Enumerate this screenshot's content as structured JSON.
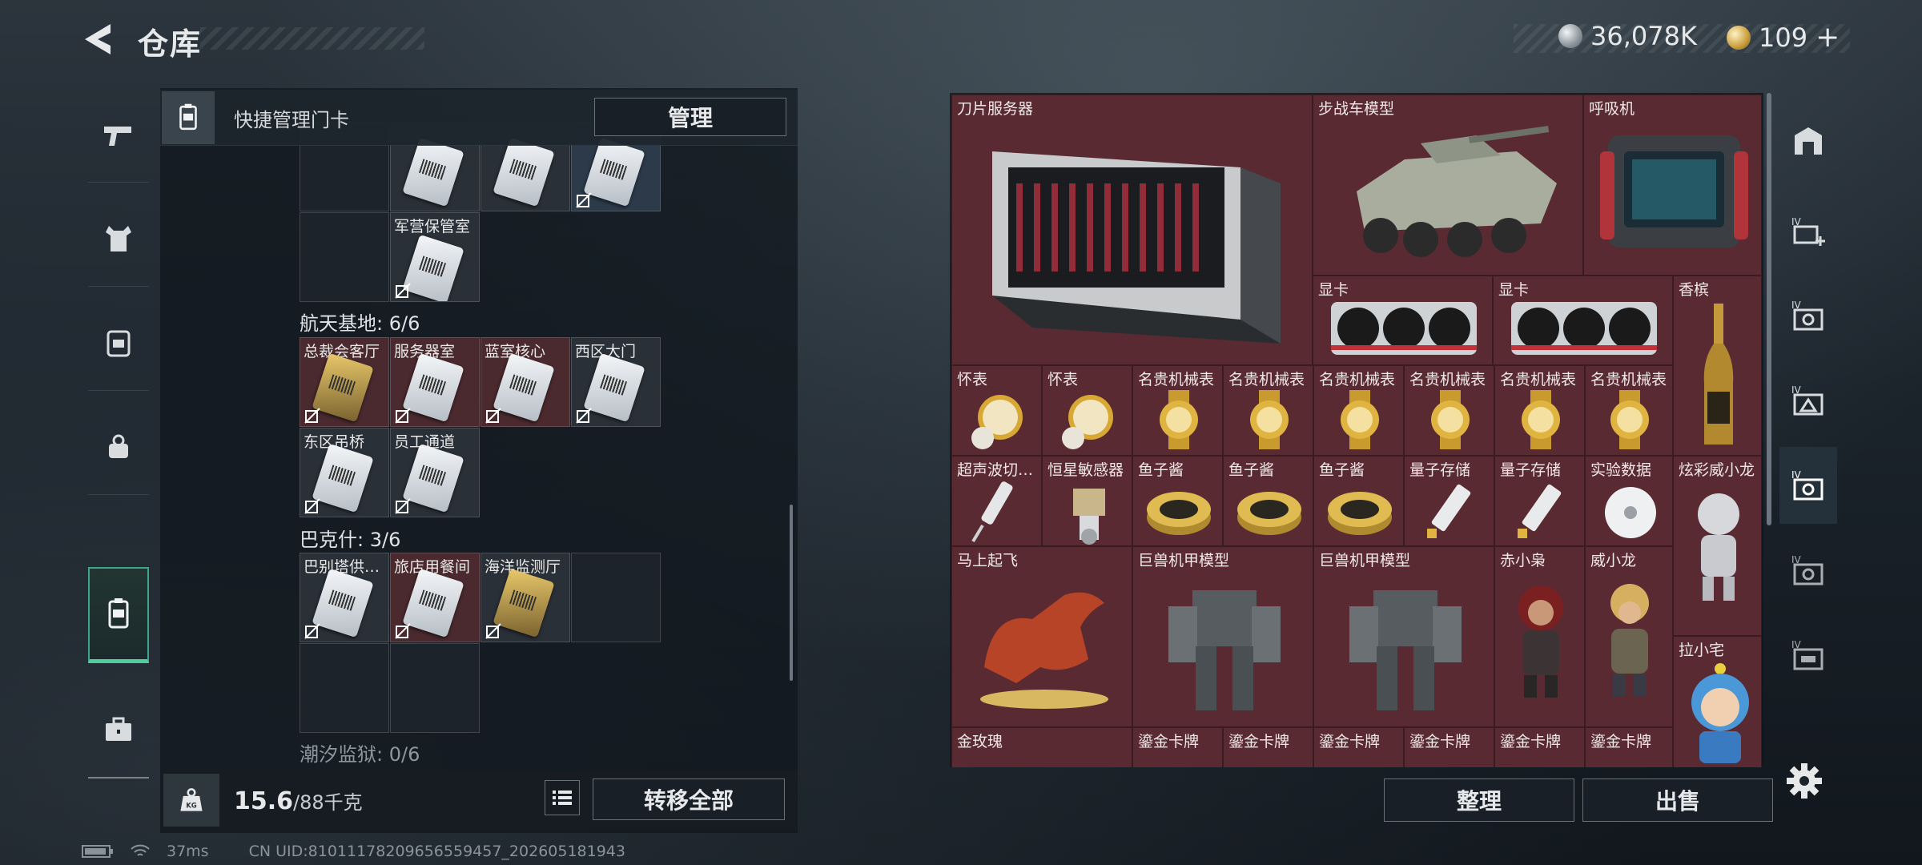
{
  "header": {
    "title": "仓库"
  },
  "currency": {
    "silver": "36,078K",
    "gold": "109",
    "gold_plus": "+"
  },
  "left_nav": {
    "items": [
      "weapon",
      "armor",
      "backpack",
      "rig",
      "keycard",
      "case"
    ],
    "active": "keycard",
    "accent": "#4fcf9e"
  },
  "quick": {
    "label": "快捷管理门卡",
    "manage_label": "管理"
  },
  "sections": {
    "hidden_row_label": "…",
    "s1_labels": [
      "军营保管室"
    ],
    "aerospace": {
      "title": "航天基地: 6/6",
      "cells": [
        "总裁会客厅",
        "服务器室",
        "蓝室核心",
        "西区大门",
        "东区吊桥",
        "员工通道"
      ]
    },
    "bakshi": {
      "title": "巴克什: 3/6",
      "cells": [
        "巴别塔供…",
        "旅店用餐间",
        "海洋监测厅"
      ]
    },
    "tide": {
      "title": "潮汐监狱: 0/6"
    }
  },
  "footer": {
    "weight": "15.6",
    "weight_max": "/88千克",
    "transfer_label": "转移全部"
  },
  "status": {
    "ping": "37ms",
    "uid": "CN UID:81011178209656559457_202605181943"
  },
  "items": [
    {
      "label": "刀片服务器"
    },
    {
      "label": "步战车模型"
    },
    {
      "label": "呼吸机"
    },
    {
      "label": "显卡"
    },
    {
      "label": "显卡"
    },
    {
      "label": "香槟"
    },
    {
      "label": "怀表"
    },
    {
      "label": "怀表"
    },
    {
      "label": "名贵机械表"
    },
    {
      "label": "名贵机械表"
    },
    {
      "label": "名贵机械表"
    },
    {
      "label": "名贵机械表"
    },
    {
      "label": "名贵机械表"
    },
    {
      "label": "名贵机械表"
    },
    {
      "label": "超声波切…"
    },
    {
      "label": "恒星敏感器"
    },
    {
      "label": "鱼子酱"
    },
    {
      "label": "鱼子酱"
    },
    {
      "label": "鱼子酱"
    },
    {
      "label": "量子存储"
    },
    {
      "label": "量子存储"
    },
    {
      "label": "实验数据"
    },
    {
      "label": "炫彩威小龙"
    },
    {
      "label": "马上起飞"
    },
    {
      "label": "巨兽机甲模型"
    },
    {
      "label": "巨兽机甲模型"
    },
    {
      "label": "赤小枭"
    },
    {
      "label": "威小龙"
    },
    {
      "label": "拉小宅"
    },
    {
      "label": "金玫瑰"
    },
    {
      "label": "鎏金卡牌"
    },
    {
      "label": "鎏金卡牌"
    },
    {
      "label": "鎏金卡牌"
    },
    {
      "label": "鎏金卡牌"
    },
    {
      "label": "鎏金卡牌"
    },
    {
      "label": "鎏金卡牌"
    }
  ],
  "right_actions": {
    "sort_label": "整理",
    "sell_label": "出售"
  },
  "colors": {
    "item_bg": "#5a2a32",
    "grid_bg": "#3f2327"
  }
}
